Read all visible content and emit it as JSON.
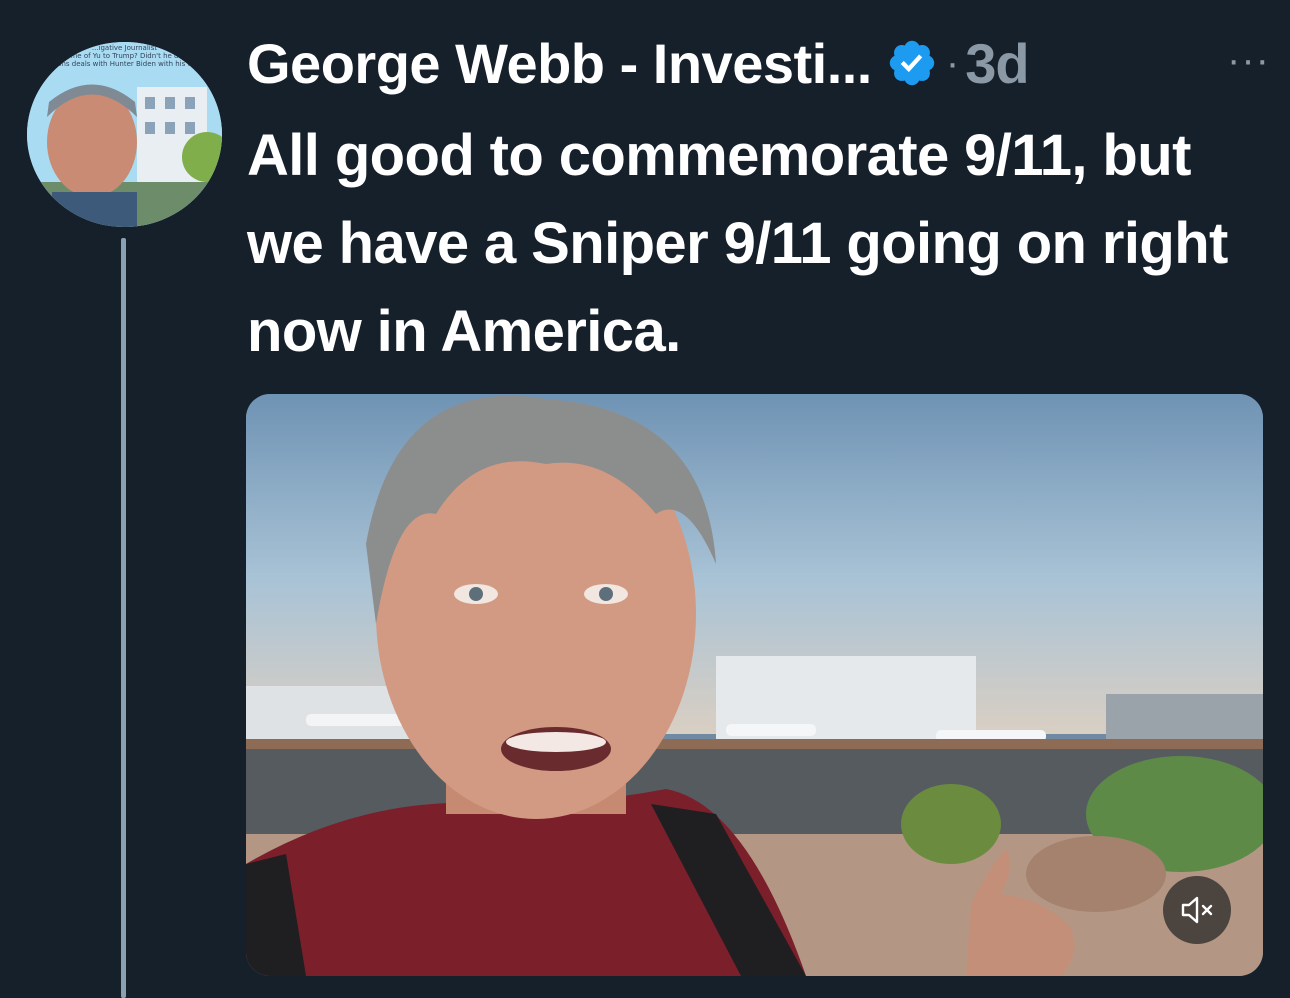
{
  "author": {
    "display_name": "George Webb - Investi...",
    "verified": true,
    "avatar_caption": "...igative Journalist\n...me of Yu to Trump? Didn't he d...\n...ons deals with Hunter Biden with his e..."
  },
  "meta": {
    "separator": "·",
    "timestamp": "3d",
    "more_label": "···"
  },
  "tweet": {
    "text": "All good to commemorate 9/11, but we have a Sniper 9/11 going on right now in America."
  },
  "media": {
    "type": "video",
    "muted": true,
    "mute_icon": "speaker-muted-icon"
  },
  "colors": {
    "background": "#15202b",
    "secondary_text": "#8b98a5",
    "verified_blue": "#1d9bf0"
  }
}
